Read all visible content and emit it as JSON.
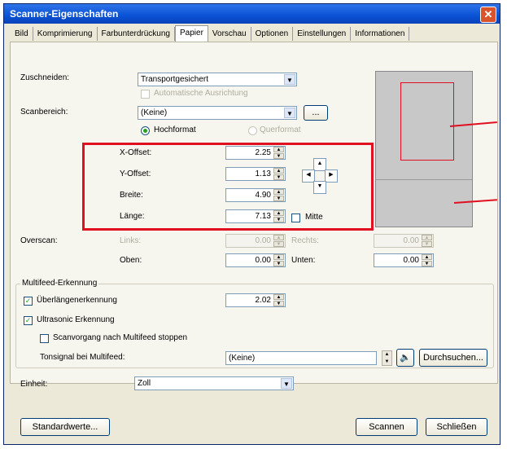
{
  "window": {
    "title": "Scanner-Eigenschaften",
    "close_symbol": "✕"
  },
  "tabs": [
    "Bild",
    "Komprimierung",
    "Farbunterdrückung",
    "Papier",
    "Vorschau",
    "Optionen",
    "Einstellungen",
    "Informationen"
  ],
  "active_tab": "Papier",
  "paper": {
    "crop_label": "Zuschneiden:",
    "crop_value": "Transportgesichert",
    "auto_align_label": "Automatische Ausrichtung",
    "scan_area_label": "Scanbereich:",
    "scan_area_value": "(Keine)",
    "scan_area_more": "...",
    "portrait_label": "Hochformat",
    "landscape_label": "Querformat",
    "x_offset_label": "X-Offset:",
    "x_offset_value": "2.25",
    "y_offset_label": "Y-Offset:",
    "y_offset_value": "1.13",
    "width_label": "Breite:",
    "width_value": "4.90",
    "length_label": "Länge:",
    "length_value": "7.13",
    "center_label": "Mitte"
  },
  "overscan": {
    "label": "Overscan:",
    "left_label": "Links:",
    "left_value": "0.00",
    "right_label": "Rechts:",
    "right_value": "0.00",
    "top_label": "Oben:",
    "top_value": "0.00",
    "bottom_label": "Unten:",
    "bottom_value": "0.00"
  },
  "multifeed": {
    "group_label": "Multifeed-Erkennung",
    "overlength_label": "Überlängenerkennung",
    "overlength_value": "2.02",
    "ultrasonic_label": "Ultrasonic Erkennung",
    "stop_label": "Scanvorgang nach Multifeed stoppen",
    "sound_label": "Tonsignal bei Multifeed:",
    "sound_value": "(Keine)",
    "browse_label": "Durchsuchen..."
  },
  "unit": {
    "label": "Einheit:",
    "value": "Zoll"
  },
  "footer": {
    "defaults_label": "Standardwerte...",
    "scan_label": "Scannen",
    "close_label": "Schließen"
  },
  "colors": {
    "title_bar": "#0a52d6",
    "highlight": "#e01020",
    "window_bg": "#ece9d8"
  },
  "icons": {
    "dropdown": "▼",
    "spin_up": "▲",
    "spin_down": "▼",
    "check": "✓",
    "speaker": "🔈"
  }
}
